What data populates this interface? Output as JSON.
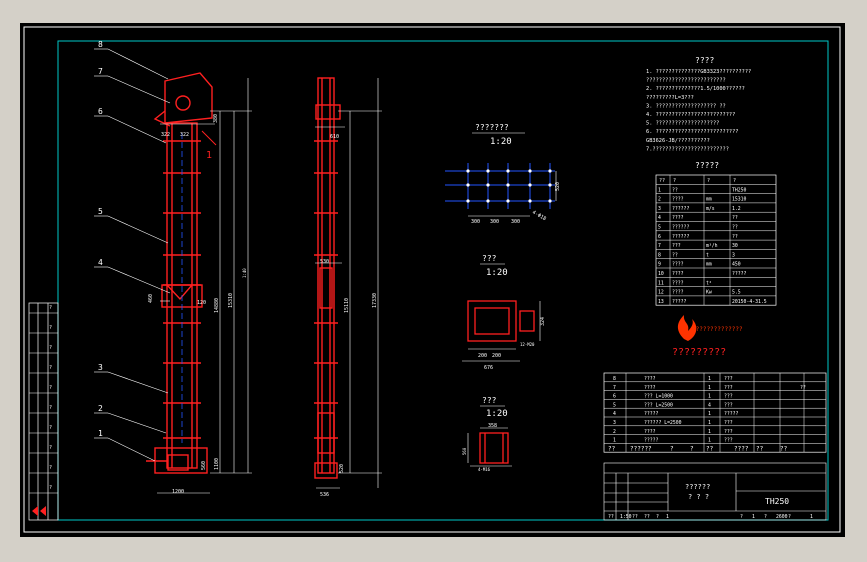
{
  "colors": {
    "background": "#000000",
    "frame": "#ffffff",
    "border": "#00c8c8",
    "part": "#ff2020",
    "dimension": "#ffffff",
    "leader": "#ffffff",
    "section": "#2255ff",
    "logo": "#ff3300"
  },
  "balloons": [
    "8",
    "7",
    "6",
    "5",
    "4",
    "3",
    "2",
    "1"
  ],
  "front_view": {
    "dims": {
      "top_w1": "322",
      "top_w2": "322",
      "top_h": "380",
      "mid_h": "14880",
      "total_h": "15310",
      "aux_h": "1100",
      "bottom_h": "560",
      "bottom_w": "1200",
      "mid_w1": "460",
      "mid_w2": "120",
      "label_ratio": "1:40"
    },
    "section_mark": "1"
  },
  "side_view": {
    "dims": {
      "top_w": "610",
      "mid_w": "530",
      "height": "15110",
      "total": "17330",
      "bottom_h": "520",
      "bottom_w": "536"
    }
  },
  "section_views": [
    {
      "title": "???????",
      "scale": "1:20",
      "dims": {
        "pitch1": "300",
        "pitch2": "300",
        "pitch3": "300",
        "height": "520",
        "note": "4-Φ18"
      }
    },
    {
      "title": "???",
      "scale": "1:20",
      "dims": {
        "d1": "200",
        "d2": "200",
        "d3": "12-M20",
        "total": "676",
        "side": "324"
      }
    },
    {
      "title": "???",
      "scale": "1:20",
      "dims": {
        "top": "358",
        "bottom": "4-M16",
        "width": "560"
      }
    }
  ],
  "notes": {
    "title": "????",
    "lines": [
      "1.  ??????????????GB3323??????????",
      "    ?????????????????????????",
      "2.  ??????????????1.5/1000??????",
      "    ?????????L=3???",
      "3.  ???????????????????  ??",
      "4.  ?????????????????????????",
      "5.  ????????????????????",
      "6.  ??????????????????????????",
      "    GB3626-JB/??????????",
      "7.????????????????????????"
    ]
  },
  "spec_table": {
    "title": "?????",
    "headers": [
      "??",
      "?",
      "?",
      "?"
    ],
    "rows": [
      [
        "1",
        "??",
        "",
        "TH250"
      ],
      [
        "2",
        "????",
        "mm",
        "15310"
      ],
      [
        "3",
        "??????",
        "m/s",
        "1.2"
      ],
      [
        "4",
        "????",
        "",
        "??"
      ],
      [
        "5",
        "??????",
        "",
        "??"
      ],
      [
        "6",
        "??????",
        "",
        "??"
      ],
      [
        "7",
        "???",
        "m³/h",
        "30"
      ],
      [
        "8",
        "??",
        "t",
        "3"
      ],
      [
        "9",
        "????",
        "mm",
        "450"
      ],
      [
        "10",
        "????",
        "",
        "?????"
      ],
      [
        "11",
        "????",
        "t²",
        ""
      ],
      [
        "12",
        "????",
        "Kw",
        "5.5"
      ],
      [
        "13",
        "?????",
        "",
        "20150-4-31.5"
      ]
    ]
  },
  "logo": {
    "banner": "??????????????",
    "caption": "?????????"
  },
  "bom": {
    "rows": [
      [
        "8",
        "????",
        "1",
        "???",
        "",
        ""
      ],
      [
        "7",
        "????",
        "1",
        "???",
        "",
        "??"
      ],
      [
        "6",
        "???  L=1000",
        "1",
        "???",
        "",
        ""
      ],
      [
        "5",
        "???  L=2500",
        "4",
        "???",
        "",
        ""
      ],
      [
        "4",
        "?????",
        "1",
        "?????",
        "",
        ""
      ],
      [
        "3",
        "??????  L=2500",
        "1",
        "???",
        "",
        ""
      ],
      [
        "2",
        "????",
        "1",
        "???",
        "",
        ""
      ],
      [
        "1",
        "????? ",
        "1",
        "???",
        "",
        ""
      ]
    ],
    "header": [
      "??",
      "??????",
      "?",
      "?",
      "??",
      "????",
      "??",
      "??"
    ]
  },
  "title_block": {
    "drawing_name": "??????",
    "drawing_sub": "?  ?  ?",
    "code": "TH250",
    "footer": [
      "??",
      "1:50",
      "??",
      "??",
      "?",
      "1",
      "?",
      "1",
      "?",
      "2600",
      "?",
      "1"
    ]
  },
  "left_strip": [
    "?",
    "?",
    "?",
    "?",
    "?",
    "?",
    "?",
    "?",
    "?",
    "?"
  ]
}
